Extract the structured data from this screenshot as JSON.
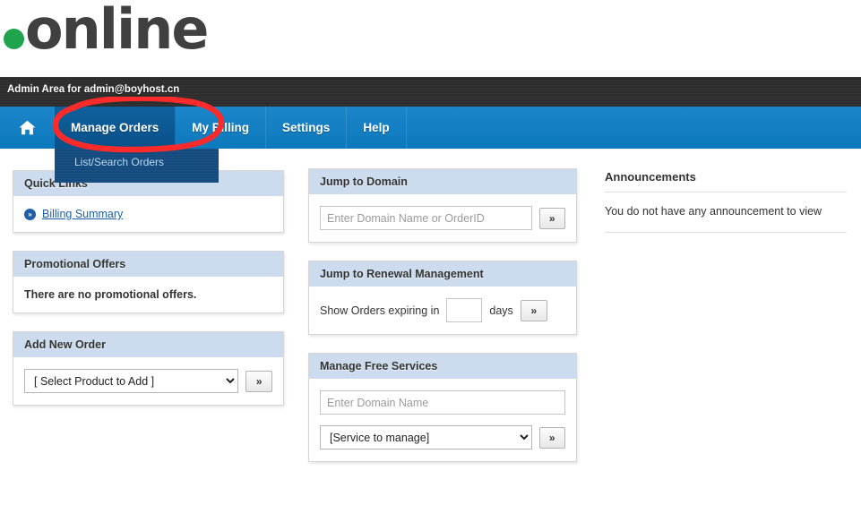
{
  "brand": {
    "dot": "green-dot",
    "name": "online",
    "dot_color": "#1fa34c"
  },
  "adminbar": {
    "text": "Admin Area for admin@boyhost.cn"
  },
  "nav": {
    "home_icon": "home-icon",
    "items": [
      {
        "label": "Manage Orders",
        "active": true
      },
      {
        "label": "My Billing",
        "active": false
      },
      {
        "label": "Settings",
        "active": false
      },
      {
        "label": "Help",
        "active": false
      }
    ],
    "dropdown": {
      "items": [
        "List/Search Orders"
      ]
    }
  },
  "annotation": {
    "shape": "red-ellipse",
    "color": "#fb2b2b",
    "target": "Manage Orders"
  },
  "left": {
    "quick_links": {
      "title": "Quick Links",
      "links": [
        {
          "label": "Billing Summary",
          "icon": "chevron-circle-icon"
        }
      ]
    },
    "promotional": {
      "title": "Promotional Offers",
      "message": "There are no promotional offers."
    },
    "add_new_order": {
      "title": "Add New Order",
      "select_value": "[ Select Product to Add ]",
      "go_label": "»"
    }
  },
  "middle": {
    "jump_to_domain": {
      "title": "Jump to Domain",
      "placeholder": "Enter Domain Name or OrderID",
      "value": "",
      "go_label": "»"
    },
    "renewal": {
      "title": "Jump to Renewal Management",
      "prefix_label": "Show Orders expiring in",
      "days_value": "",
      "suffix_label": "days",
      "go_label": "»"
    },
    "free_services": {
      "title": "Manage Free Services",
      "placeholder": "Enter Domain Name",
      "value": "",
      "select_value": "[Service to manage]",
      "go_label": "»"
    }
  },
  "right": {
    "announcements": {
      "title": "Announcements",
      "empty_text": "You do not have any announcement to view"
    }
  },
  "colors": {
    "nav_blue": "#1380c4",
    "nav_active": "#0b5a96",
    "dropdown_blue": "#134b80",
    "panel_head": "#ccdcee",
    "link_blue": "#1c5fa8",
    "adminbar": "#2d2d2d",
    "annotation_red": "#fb2b2b"
  }
}
